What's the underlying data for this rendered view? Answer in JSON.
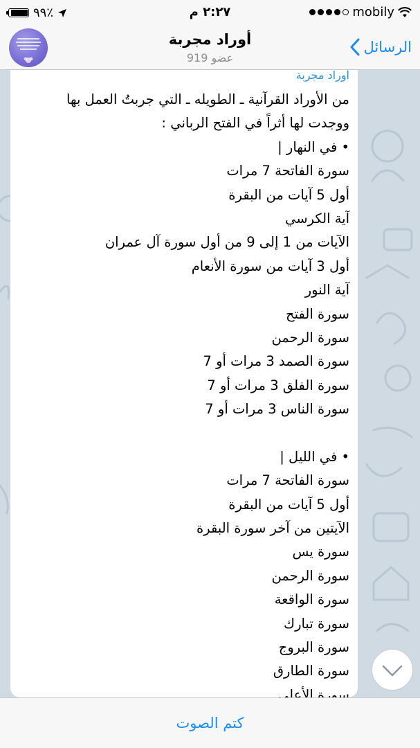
{
  "status_bar": {
    "battery_percent": "٩٩٪",
    "battery_level": 0.99,
    "time": "٢:٢٧ م",
    "carrier": "mobily"
  },
  "header": {
    "back_label": "الرسائل",
    "title": "أوراد مجربة",
    "subtitle": "919 عضو"
  },
  "message": {
    "sender": "أوراد مجربة",
    "lines": [
      "من الأوراد القرآنية ـ الطويله ـ التي جربتُ العمل بها",
      "ووجدت لها أثراً في الفتح الرباني :",
      "• في النهار |",
      "سورة الفاتحة 7 مرات",
      "أول 5 آيات من البقرة",
      "آية الكرسي",
      "الآيات من 1 إلى 9 من أول سورة آل عمران",
      "أول 3 آيات من سورة الأنعام",
      "آية النور",
      "سورة الفتح",
      "سورة الرحمن",
      "سورة الصمد 3 مرات أو 7",
      "سورة الفلق 3 مرات أو 7",
      "سورة الناس 3 مرات أو 7",
      "",
      "• في الليل |",
      "سورة الفاتحة 7 مرات",
      "أول 5 آيات من البقرة",
      "الآيتين من آخر سورة البقرة",
      "سورة يس",
      "سورة الرحمن",
      "سورة الواقعة",
      "سورة تبارك",
      "سورة البروج",
      "سورة الطارق",
      "سورة الأعلى"
    ]
  },
  "bottom_bar": {
    "mute_label": "كتم الصوت"
  },
  "icons": {
    "back": "chevron-left-icon",
    "scroll_down": "chevron-down-icon",
    "wifi": "wifi-icon",
    "location": "location-arrow-icon"
  },
  "colors": {
    "accent": "#1d8cf2",
    "sender": "#2d8fd5",
    "chat_background": "#cfdae3"
  }
}
